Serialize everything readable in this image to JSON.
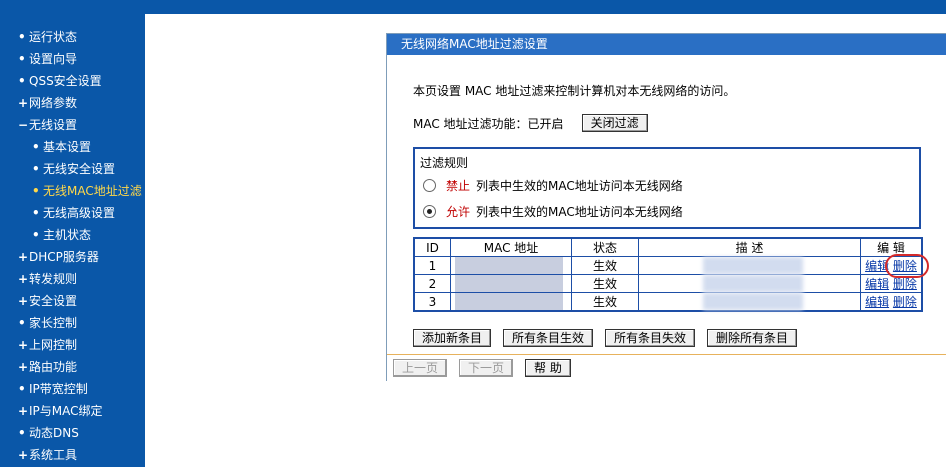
{
  "nav": {
    "items": [
      {
        "label": "运行状态",
        "marker": "•",
        "level": 1
      },
      {
        "label": "设置向导",
        "marker": "•",
        "level": 1
      },
      {
        "label": "QSS安全设置",
        "marker": "•",
        "level": 1
      },
      {
        "label": "网络参数",
        "marker": "+",
        "level": 1
      },
      {
        "label": "无线设置",
        "marker": "−",
        "level": 1
      },
      {
        "label": "基本设置",
        "marker": "•",
        "level": 2
      },
      {
        "label": "无线安全设置",
        "marker": "•",
        "level": 2
      },
      {
        "label": "无线MAC地址过滤",
        "marker": "•",
        "level": 2,
        "active": true
      },
      {
        "label": "无线高级设置",
        "marker": "•",
        "level": 2
      },
      {
        "label": "主机状态",
        "marker": "•",
        "level": 2
      },
      {
        "label": "DHCP服务器",
        "marker": "+",
        "level": 1
      },
      {
        "label": "转发规则",
        "marker": "+",
        "level": 1
      },
      {
        "label": "安全设置",
        "marker": "+",
        "level": 1
      },
      {
        "label": "家长控制",
        "marker": "•",
        "level": 1
      },
      {
        "label": "上网控制",
        "marker": "+",
        "level": 1
      },
      {
        "label": "路由功能",
        "marker": "+",
        "level": 1
      },
      {
        "label": "IP带宽控制",
        "marker": "•",
        "level": 1
      },
      {
        "label": "IP与MAC绑定",
        "marker": "+",
        "level": 1
      },
      {
        "label": "动态DNS",
        "marker": "•",
        "level": 1
      },
      {
        "label": "系统工具",
        "marker": "+",
        "level": 1
      }
    ]
  },
  "panel": {
    "title": "无线网络MAC地址过滤设置",
    "description": "本页设置 MAC 地址过滤来控制计算机对本无线网络的访问。",
    "filter_label": "MAC 地址过滤功能：",
    "filter_status": "已开启",
    "toggle_button": "关闭过滤",
    "rules": {
      "title": "过滤规则",
      "options": [
        {
          "keyword": "禁止",
          "text": "列表中生效的MAC地址访问本无线网络",
          "selected": false
        },
        {
          "keyword": "允许",
          "text": "列表中生效的MAC地址访问本无线网络",
          "selected": true
        }
      ]
    },
    "table": {
      "headers": [
        "ID",
        "MAC 地址",
        "状态",
        "描  述",
        "编  辑"
      ],
      "rows": [
        {
          "id": "1",
          "status": "生效",
          "edit": "编辑",
          "delete": "删除"
        },
        {
          "id": "2",
          "status": "生效",
          "edit": "编辑",
          "delete": "删除"
        },
        {
          "id": "3",
          "status": "生效",
          "edit": "编辑",
          "delete": "删除"
        }
      ]
    },
    "actions": [
      "添加新条目",
      "所有条目生效",
      "所有条目失效",
      "删除所有条目"
    ],
    "footer": {
      "prev": "上一页",
      "next": "下一页",
      "help": "帮 助"
    },
    "colors": {
      "header_bg": "#2a6fc4",
      "nav_bg": "#0a57a8",
      "highlight": "#d42a2a",
      "keyword": "#c00000"
    }
  }
}
